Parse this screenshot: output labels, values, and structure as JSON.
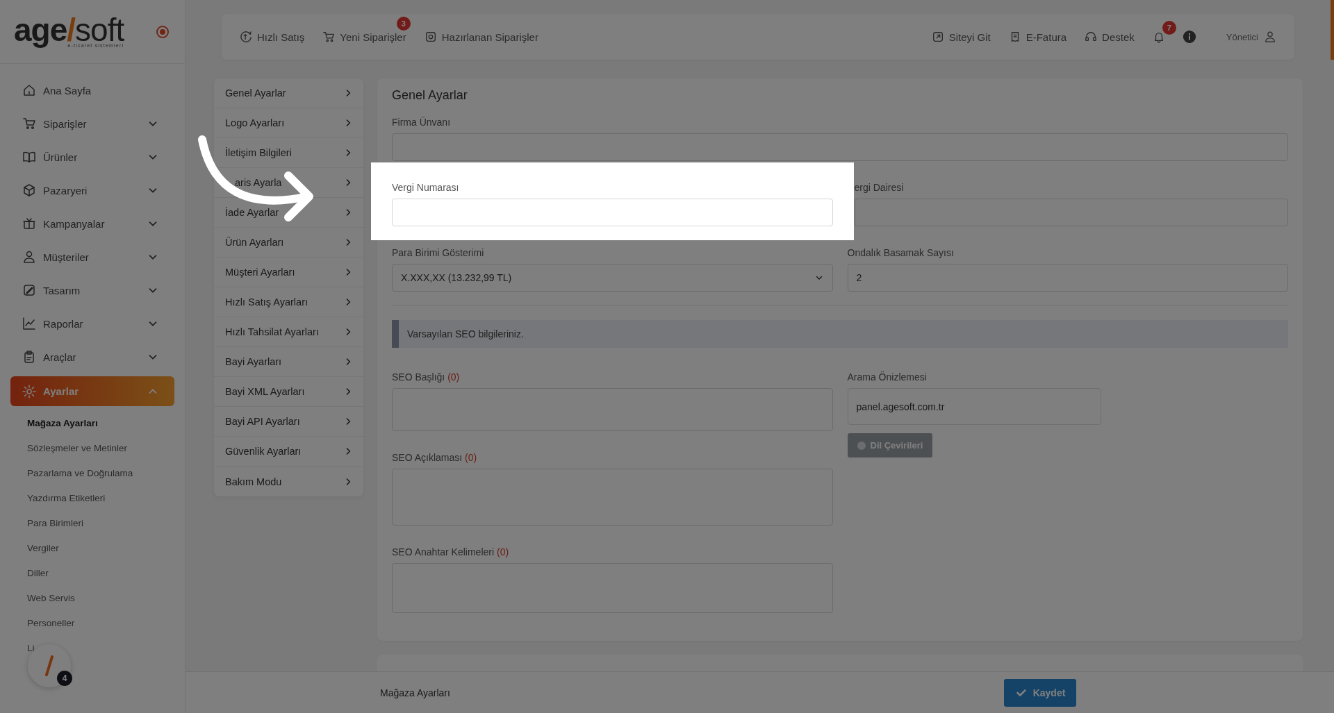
{
  "logo": {
    "brand_start": "age",
    "brand_slash": "/",
    "brand_end": "soft",
    "tagline": "e-ticaret sistemleri"
  },
  "topbar": {
    "left": [
      {
        "label": "Hızlı Satış"
      },
      {
        "label": "Yeni Siparişler",
        "badge": "3"
      },
      {
        "label": "Hazırlanan Siparişler"
      }
    ],
    "right": [
      {
        "label": "Siteyi Git"
      },
      {
        "label": "E-Fatura"
      },
      {
        "label": "Destek"
      }
    ],
    "notifications": {
      "badge": "7"
    },
    "user": {
      "label": "Yönetici"
    }
  },
  "sidebar": {
    "items": [
      {
        "label": "Ana Sayfa",
        "kind": "link",
        "selected": false
      },
      {
        "label": "Siparişler",
        "kind": "group",
        "selected": false,
        "expanded": false
      },
      {
        "label": "Ürünler",
        "kind": "group",
        "selected": false,
        "expanded": false
      },
      {
        "label": "Pazaryeri",
        "kind": "group",
        "selected": false,
        "expanded": false
      },
      {
        "label": "Kampanyalar",
        "kind": "group",
        "selected": false,
        "expanded": false
      },
      {
        "label": "Müşteriler",
        "kind": "group",
        "selected": false,
        "expanded": false
      },
      {
        "label": "Tasarım",
        "kind": "group",
        "selected": false,
        "expanded": false
      },
      {
        "label": "Raporlar",
        "kind": "group",
        "selected": false,
        "expanded": false
      },
      {
        "label": "Araçlar",
        "kind": "group",
        "selected": false,
        "expanded": false
      },
      {
        "label": "Ayarlar",
        "kind": "group",
        "selected": true,
        "expanded": true,
        "children": [
          {
            "label": "Mağaza Ayarları",
            "selected": true
          },
          {
            "label": "Sözleşmeler ve Metinler",
            "selected": false
          },
          {
            "label": "Pazarlama ve Doğrulama",
            "selected": false
          },
          {
            "label": "Yazdırma Etiketleri",
            "selected": false
          },
          {
            "label": "Para Birimleri",
            "selected": false
          },
          {
            "label": "Vergiler",
            "selected": false
          },
          {
            "label": "Diller",
            "selected": false
          },
          {
            "label": "Web Servis",
            "selected": false
          },
          {
            "label": "Personeller",
            "selected": false
          },
          {
            "label": "Li",
            "selected": false
          }
        ]
      }
    ]
  },
  "floating_button": {
    "badge": "4"
  },
  "settings_menu": {
    "items": [
      {
        "label": "Genel Ayarlar"
      },
      {
        "label": "Logo Ayarları"
      },
      {
        "label": "İletişim Bilgileri"
      },
      {
        "label": "aris Ayarla"
      },
      {
        "label": "İade Ayarlar"
      },
      {
        "label": "Ürün Ayarları"
      },
      {
        "label": "Müşteri Ayarları"
      },
      {
        "label": "Hızlı Satış Ayarları"
      },
      {
        "label": "Hızlı Tahsilat Ayarları"
      },
      {
        "label": "Bayi Ayarları"
      },
      {
        "label": "Bayi XML Ayarları"
      },
      {
        "label": "Bayi API Ayarları"
      },
      {
        "label": "Güvenlik Ayarları"
      },
      {
        "label": "Bakım Modu"
      }
    ]
  },
  "form": {
    "title": "Genel Ayarlar",
    "company_name": {
      "label": "Firma Ünvanı"
    },
    "tax_number": {
      "label": "Vergi Numarası",
      "highlighted": true
    },
    "tax_office": {
      "label": "ergi Dairesi"
    },
    "currency_format": {
      "label": "Para Birimi Gösterimi",
      "value": "X.XXX,XX (13.232,99 TL)"
    },
    "decimals": {
      "label": "Ondalık Basamak Sayısı",
      "value": "2"
    },
    "seo_notice": "Varsayılan SEO bilgileriniz.",
    "seo_fields": [
      {
        "label": "SEO Başlığı",
        "count": "(0)"
      },
      {
        "label": "SEO Açıklaması",
        "count": "(0)"
      },
      {
        "label": "SEO Anahtar Kelimeleri",
        "count": "(0)"
      }
    ],
    "preview": {
      "label": "Arama Önizlemesi",
      "url": "panel.agesoft.com.tr"
    },
    "translations_button": {
      "label": "Dil Çevirileri",
      "disabled": true
    }
  },
  "footer": {
    "title": "Mağaza Ayarları",
    "save_button": "Kaydet"
  }
}
